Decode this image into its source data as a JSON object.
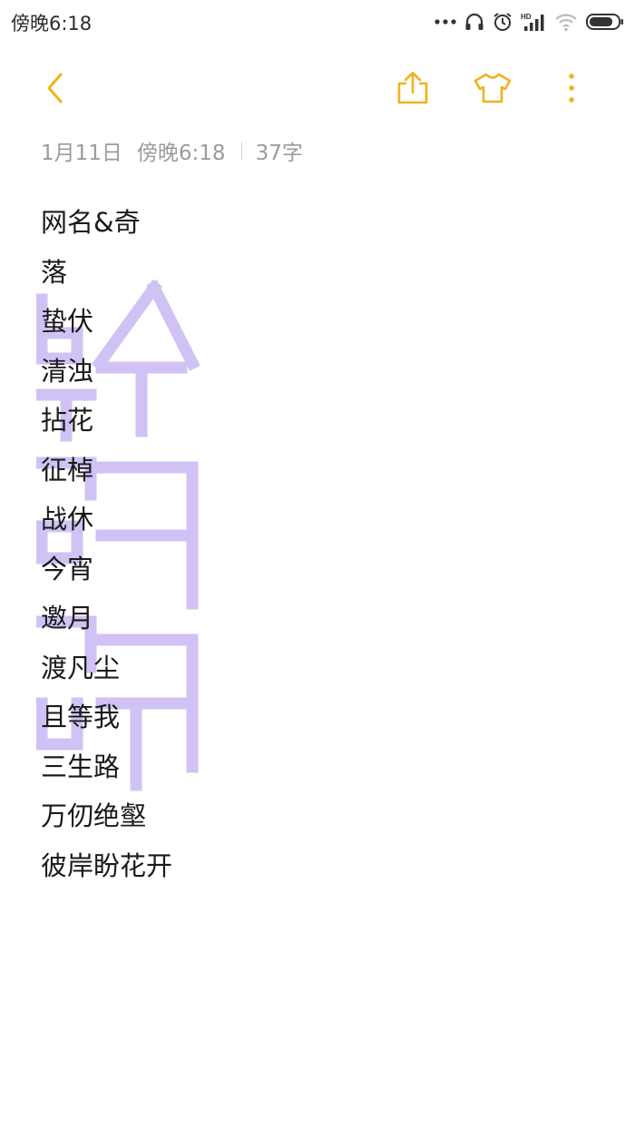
{
  "status_bar": {
    "time": "傍晚6:18",
    "icons": [
      "more-dots-icon",
      "headset-icon",
      "alarm-icon",
      "hd-signal-icon",
      "wifi-icon",
      "battery-icon"
    ],
    "signal_badge": "HD"
  },
  "toolbar": {
    "accent_color": "#F2B21B",
    "icons": [
      "back-chevron-icon",
      "share-icon",
      "theme-shirt-icon",
      "more-vertical-icon"
    ]
  },
  "note_meta": {
    "date": "1月11日",
    "time": "傍晚6:18",
    "char_count": "37字"
  },
  "note": {
    "lines": [
      "网名&奇",
      "落",
      "蛰伏",
      "清浊",
      "拈花",
      "征棹",
      "战休",
      "今宵",
      "邀月",
      "渡凡尘",
      "且等我",
      "三生路",
      "万仞绝壑",
      "彼岸盼花开"
    ]
  },
  "watermark": {
    "color": "#C8B8F4"
  }
}
